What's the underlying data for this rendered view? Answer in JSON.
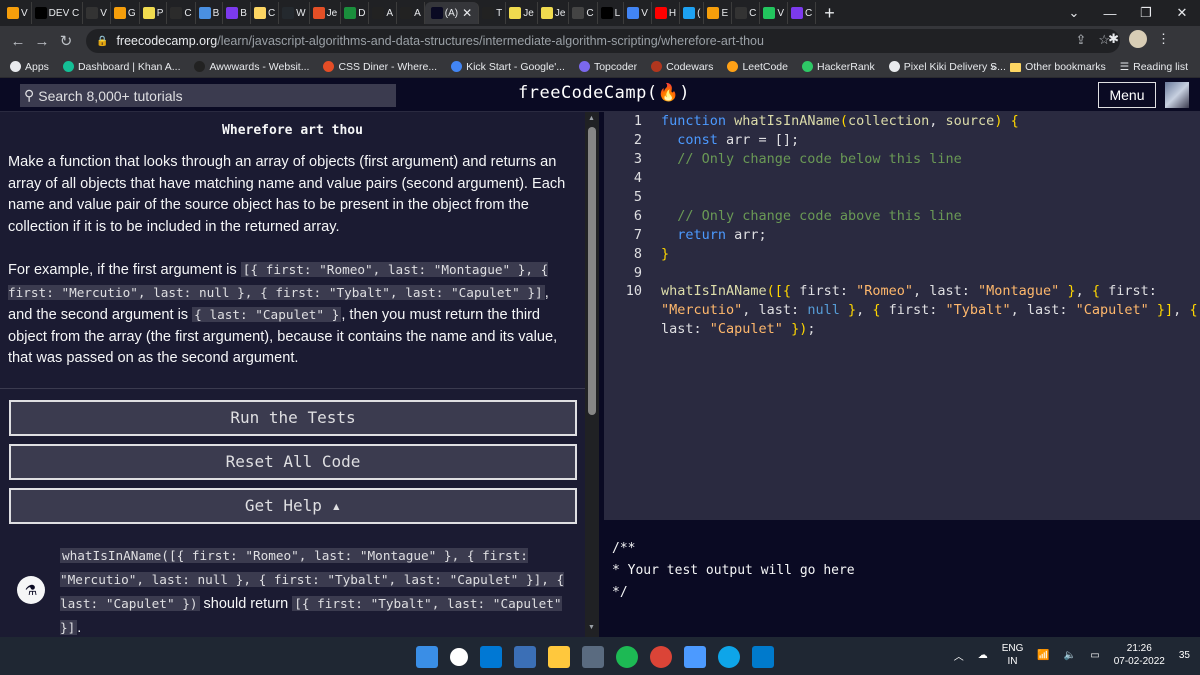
{
  "browser": {
    "tabs": [
      {
        "icon": "dev-icon",
        "label": "V"
      },
      {
        "icon": "dev-icon",
        "label": "DEV C"
      },
      {
        "icon": "code-icon",
        "label": "V"
      },
      {
        "icon": "gear-icon",
        "label": "G"
      },
      {
        "icon": "js-icon",
        "label": "P"
      },
      {
        "icon": "bird-icon",
        "label": "C"
      },
      {
        "icon": "circle-icon",
        "label": "B"
      },
      {
        "icon": "b-icon",
        "label": "B"
      },
      {
        "icon": "square-icon",
        "label": "C"
      },
      {
        "icon": "github-icon",
        "label": "W"
      },
      {
        "icon": "bars-icon",
        "label": "Je"
      },
      {
        "icon": "d-icon",
        "label": "D"
      },
      {
        "icon": "bird-icon",
        "label": "A"
      },
      {
        "icon": "bird-icon",
        "label": "A"
      },
      {
        "icon": "fcc-icon",
        "label": "(A)",
        "active": true
      },
      {
        "icon": "bird-icon",
        "label": "T"
      },
      {
        "icon": "js-icon",
        "label": "Je"
      },
      {
        "icon": "js-icon",
        "label": "Je"
      },
      {
        "icon": "grid-icon",
        "label": "C"
      },
      {
        "icon": "mdn-icon",
        "label": "L"
      },
      {
        "icon": "google-icon",
        "label": "V"
      },
      {
        "icon": "youtube-icon",
        "label": "H"
      },
      {
        "icon": "twitter-icon",
        "label": "("
      },
      {
        "icon": "gear-icon",
        "label": "E"
      },
      {
        "icon": "dots-icon",
        "label": "C"
      },
      {
        "icon": "game-icon",
        "label": "V"
      },
      {
        "icon": "u-icon",
        "label": "C"
      }
    ],
    "new_tab": "+",
    "url_host": "freecodecamp.org",
    "url_path": "/learn/javascript-algorithms-and-data-structures/intermediate-algorithm-scripting/wherefore-art-thou",
    "bookmarks": [
      {
        "label": "Apps",
        "color": "#e8eaed"
      },
      {
        "label": "Dashboard | Khan A...",
        "color": "#14bf96"
      },
      {
        "label": "Awwwards - Websit...",
        "color": "#222222"
      },
      {
        "label": "CSS Diner - Where...",
        "color": "#e44d26"
      },
      {
        "label": "Kick Start - Google'...",
        "color": "#4285f4"
      },
      {
        "label": "Topcoder",
        "color": "#7b68ee"
      },
      {
        "label": "Codewars",
        "color": "#b1361e"
      },
      {
        "label": "LeetCode",
        "color": "#ffa116"
      },
      {
        "label": "HackerRank",
        "color": "#2ec866"
      },
      {
        "label": "Pixel Kiki Delivery S...",
        "color": "#e8eaed"
      }
    ],
    "bookmarks_more": "»",
    "other_bookmarks": "Other bookmarks",
    "reading_list": "Reading list"
  },
  "fcc": {
    "search_placeholder": "Search 8,000+ tutorials",
    "logo": "freeCodeCamp(🔥)",
    "menu": "Menu"
  },
  "challenge": {
    "title": "Wherefore art thou",
    "para1": "Make a function that looks through an array of objects (first argument) and returns an array of all objects that have matching name and value pairs (second argument). Each name and value pair of the source object has to be present in the object from the collection if it is to be included in the returned array.",
    "para2_a": "For example, if the first argument is ",
    "para2_code1": "[{ first: \"Romeo\", last: \"Montague\" }, { first: \"Mercutio\", last: null }, { first: \"Tybalt\", last: \"Capulet\" }]",
    "para2_b": ", and the second argument is ",
    "para2_code2": "{ last: \"Capulet\" }",
    "para2_c": ", then you must return the third object from the array (the first argument), because it contains the name and its value, that was passed on as the second argument.",
    "run_tests": "Run the Tests",
    "reset": "Reset All Code",
    "help": "Get Help ▴",
    "hint_code1": "whatIsInAName([{ first: \"Romeo\", last: \"Montague\" }, { first: \"Mercutio\", last: null }, { first: \"Tybalt\", last: \"Capulet\" }], { last: \"Capulet\" })",
    "hint_text": " should return ",
    "hint_code2": "[{ first: \"Tybalt\", last: \"Capulet\" }]",
    "hint_end": "."
  },
  "editor": {
    "line_numbers": [
      "1",
      "2",
      "3",
      "4",
      "5",
      "6",
      "7",
      "8",
      "9",
      "10"
    ],
    "console_lines": [
      "/**",
      "* Your test output will go here",
      "*/"
    ]
  },
  "taskbar": {
    "lang": "ENG",
    "region": "IN",
    "time": "21:26",
    "date": "07-02-2022",
    "notif": "35"
  }
}
